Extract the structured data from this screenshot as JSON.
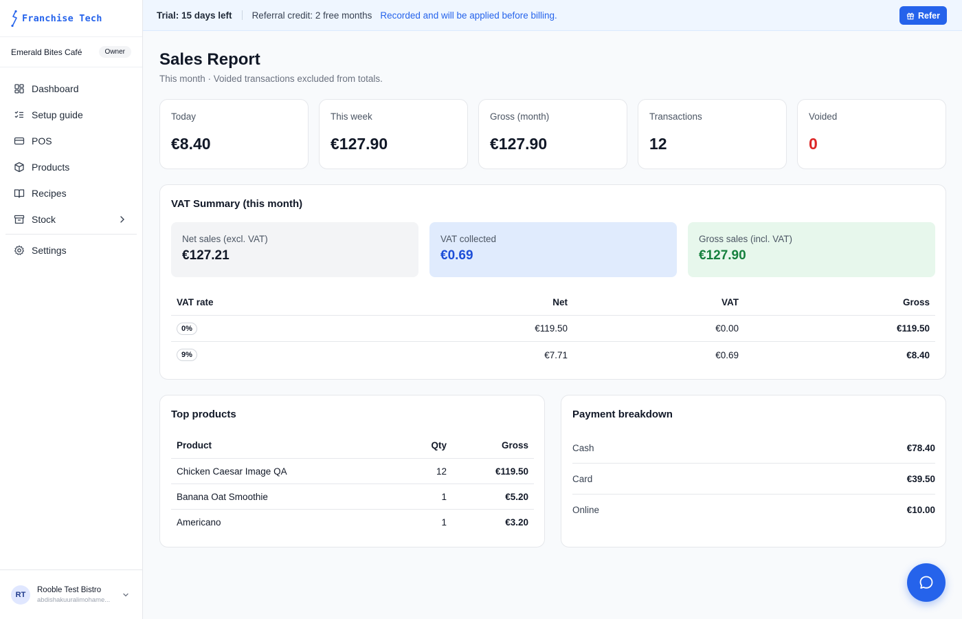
{
  "brand": {
    "name": "Franchise Tech",
    "accent": "#2563eb"
  },
  "org": {
    "name": "Emerald Bites Café",
    "role": "Owner"
  },
  "sidebar": {
    "items": [
      {
        "label": "Dashboard",
        "icon": "dashboard-icon"
      },
      {
        "label": "Setup guide",
        "icon": "list-check-icon"
      },
      {
        "label": "POS",
        "icon": "credit-card-icon"
      },
      {
        "label": "Products",
        "icon": "box-icon"
      },
      {
        "label": "Recipes",
        "icon": "book-icon"
      },
      {
        "label": "Stock",
        "icon": "archive-icon"
      },
      {
        "label": "Settings",
        "icon": "gear-icon"
      }
    ]
  },
  "user": {
    "initials": "RT",
    "name": "Rooble Test Bistro",
    "email": "abdishakuuralimohame..."
  },
  "banner": {
    "trial": "Trial: 15 days left",
    "credit": "Referral credit: 2 free months",
    "note": "Recorded and will be applied before billing.",
    "refer_label": "Refer"
  },
  "page": {
    "title": "Sales Report",
    "subtitle": "This month · Voided transactions excluded from totals."
  },
  "stats": [
    {
      "label": "Today",
      "value": "€8.40"
    },
    {
      "label": "This week",
      "value": "€127.90"
    },
    {
      "label": "Gross (month)",
      "value": "€127.90"
    },
    {
      "label": "Transactions",
      "value": "12"
    },
    {
      "label": "Voided",
      "value": "0"
    }
  ],
  "vat": {
    "title": "VAT Summary (this month)",
    "boxes": [
      {
        "label": "Net sales (excl. VAT)",
        "value": "€127.21"
      },
      {
        "label": "VAT collected",
        "value": "€0.69"
      },
      {
        "label": "Gross sales (incl. VAT)",
        "value": "€127.90"
      }
    ],
    "columns": [
      "VAT rate",
      "Net",
      "VAT",
      "Gross"
    ],
    "rows": [
      {
        "rate": "0%",
        "net": "€119.50",
        "vat": "€0.00",
        "gross": "€119.50"
      },
      {
        "rate": "9%",
        "net": "€7.71",
        "vat": "€0.69",
        "gross": "€8.40"
      }
    ]
  },
  "top_products": {
    "title": "Top products",
    "columns": [
      "Product",
      "Qty",
      "Gross"
    ],
    "rows": [
      {
        "product": "Chicken Caesar Image QA",
        "qty": "12",
        "gross": "€119.50"
      },
      {
        "product": "Banana Oat Smoothie",
        "qty": "1",
        "gross": "€5.20"
      },
      {
        "product": "Americano",
        "qty": "1",
        "gross": "€3.20"
      }
    ]
  },
  "payments": {
    "title": "Payment breakdown",
    "rows": [
      {
        "label": "Cash",
        "amount": "€78.40"
      },
      {
        "label": "Card",
        "amount": "€39.50"
      },
      {
        "label": "Online",
        "amount": "€10.00"
      }
    ]
  }
}
